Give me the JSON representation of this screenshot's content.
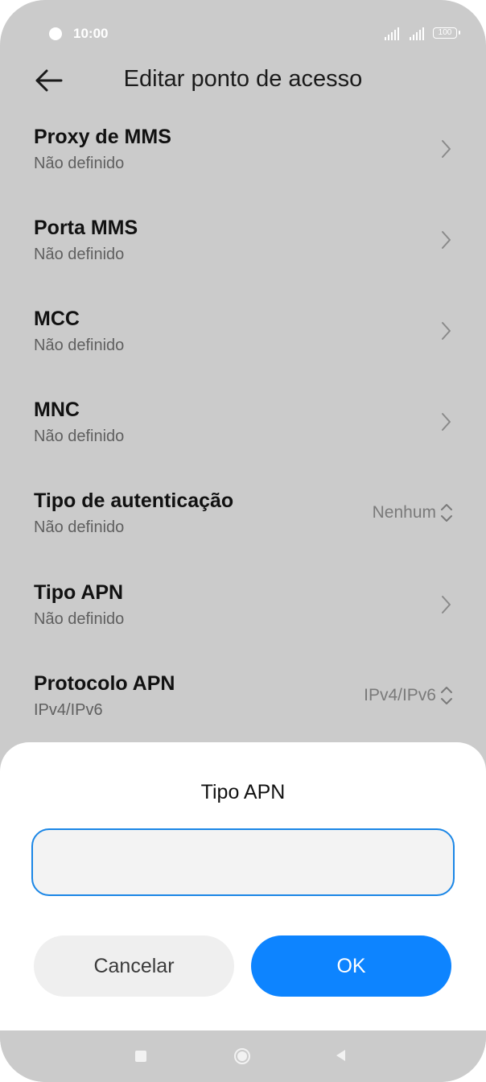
{
  "status_bar": {
    "time": "10:00",
    "battery": "100"
  },
  "header": {
    "title": "Editar ponto de acesso",
    "back_icon": "arrow-left-icon"
  },
  "settings": [
    {
      "label": "Proxy de MMS",
      "value": "Não definido",
      "control": "chevron"
    },
    {
      "label": "Porta MMS",
      "value": "Não definido",
      "control": "chevron"
    },
    {
      "label": "MCC",
      "value": "Não definido",
      "control": "chevron"
    },
    {
      "label": "MNC",
      "value": "Não definido",
      "control": "chevron"
    },
    {
      "label": "Tipo de autenticação",
      "value": "Não definido",
      "control": "dropdown",
      "selected": "Nenhum"
    },
    {
      "label": "Tipo APN",
      "value": "Não definido",
      "control": "chevron"
    },
    {
      "label": "Protocolo APN",
      "value": "IPv4/IPv6",
      "control": "dropdown",
      "selected": "IPv4/IPv6"
    }
  ],
  "dialog": {
    "title": "Tipo APN",
    "input_value": "",
    "cancel_label": "Cancelar",
    "ok_label": "OK"
  },
  "colors": {
    "accent": "#0d84ff",
    "field_border": "#1a86e6",
    "overlay_background": "#cbcbcb"
  }
}
